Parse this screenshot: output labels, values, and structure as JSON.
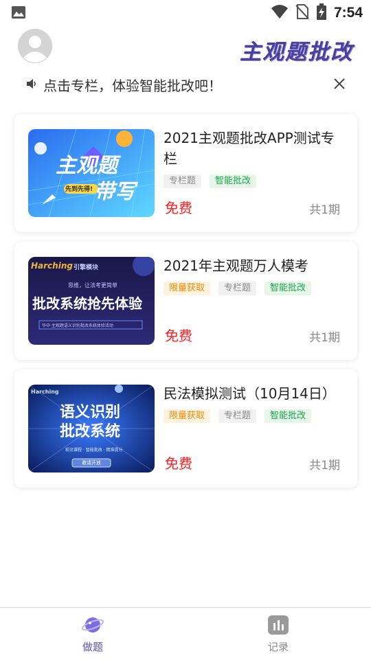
{
  "status_bar": {
    "time": "7:54"
  },
  "header": {
    "brand_title": "主观题批改"
  },
  "notice": {
    "text": "点击专栏，体验智能批改吧！"
  },
  "columns": [
    {
      "title": "2021主观题批改APP测试专栏",
      "tags": [
        "专栏题",
        "智能批改"
      ],
      "price": "免费",
      "periods": "共1期",
      "thumb": {
        "main": "主观题",
        "sub": "带写",
        "badge": "先到先得!"
      }
    },
    {
      "title": "2021年主观题万人模考",
      "tags": [
        "限量获取",
        "专栏题",
        "智能批改"
      ],
      "price": "免费",
      "periods": "共1期",
      "thumb": {
        "brand": "Harching",
        "brand_cn": "引擎模块",
        "small": "思维，让法考更简单",
        "main": "批改系统抢先体验",
        "footer": "华中·主观题语义识别批改系统体验活动"
      }
    },
    {
      "title": "民法模拟测试（10月14日）",
      "tags": [
        "限量获取",
        "专栏题",
        "智能批改"
      ],
      "price": "免费",
      "periods": "共1期",
      "thumb": {
        "brand": "Harching",
        "main1": "语义识别",
        "main2": "批改系统",
        "sub": "前沿课程 · 智能批改 · 精准提分",
        "button": "邀请开放"
      }
    }
  ],
  "bottom_nav": [
    {
      "label": "做题",
      "icon": "planet-icon",
      "active": true
    },
    {
      "label": "记录",
      "icon": "bar-chart-icon",
      "active": false
    }
  ],
  "colors": {
    "accent": "#5b4db8",
    "price": "#ff1f1f",
    "tag_green": "#1ea54a",
    "tag_orange": "#f08a00"
  }
}
